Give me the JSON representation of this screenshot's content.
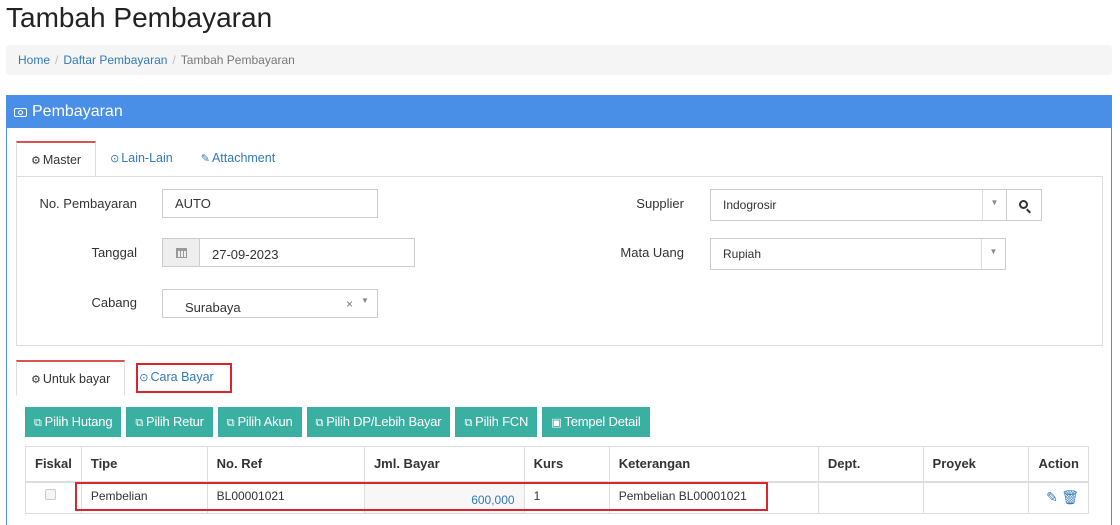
{
  "page_title": "Tambah Pembayaran",
  "breadcrumb": {
    "home": "Home",
    "list": "Daftar Pembayaran",
    "current": "Tambah Pembayaran",
    "separator": "/"
  },
  "panel": {
    "title": "Pembayaran",
    "icon": "money-icon"
  },
  "top_tabs": [
    {
      "label": "Master",
      "icon": "cogs-icon",
      "icon_glyph": "⚙"
    },
    {
      "label": "Lain-Lain",
      "icon": "check-circle-icon",
      "icon_glyph": "⊙"
    },
    {
      "label": "Attachment",
      "icon": "paperclip-icon",
      "icon_glyph": "✎"
    }
  ],
  "form": {
    "no_pembayaran_label": "No. Pembayaran",
    "no_pembayaran_value": "AUTO",
    "tanggal_label": "Tanggal",
    "tanggal_value": "27-09-2023",
    "cabang_label": "Cabang",
    "cabang_value": "Surabaya",
    "supplier_label": "Supplier",
    "supplier_value": "Indogrosir",
    "mata_uang_label": "Mata Uang",
    "mata_uang_value": "Rupiah"
  },
  "bottom_tabs": [
    {
      "label": "Untuk bayar",
      "icon": "cogs-icon",
      "icon_glyph": "⚙"
    },
    {
      "label": "Cara Bayar",
      "icon": "check-circle-icon",
      "icon_glyph": "⊙"
    }
  ],
  "buttons": [
    {
      "label": "Pilih Hutang",
      "icon": "copy-icon"
    },
    {
      "label": "Pilih Retur",
      "icon": "copy-icon"
    },
    {
      "label": "Pilih Akun",
      "icon": "copy-icon"
    },
    {
      "label": "Pilih DP/Lebih Bayar",
      "icon": "copy-icon"
    },
    {
      "label": "Pilih FCN",
      "icon": "copy-icon"
    },
    {
      "label": "Tempel Detail",
      "icon": "paste-icon"
    }
  ],
  "table": {
    "headers": [
      "Fiskal",
      "Tipe",
      "No. Ref",
      "Jml. Bayar",
      "Kurs",
      "Keterangan",
      "Dept.",
      "Proyek",
      "Action"
    ],
    "rows": [
      {
        "fiskal": false,
        "tipe": "Pembelian",
        "no_ref": "BL00001021",
        "jml_bayar": "600,000",
        "kurs": "1",
        "keterangan": "Pembelian BL00001021",
        "dept": "",
        "proyek": ""
      }
    ]
  },
  "colors": {
    "panel_header": "#4a8fe7",
    "button": "#3ab0a2",
    "link": "#337ab7",
    "active_tab_border": "#d9534f",
    "highlight": "#d9262c"
  }
}
